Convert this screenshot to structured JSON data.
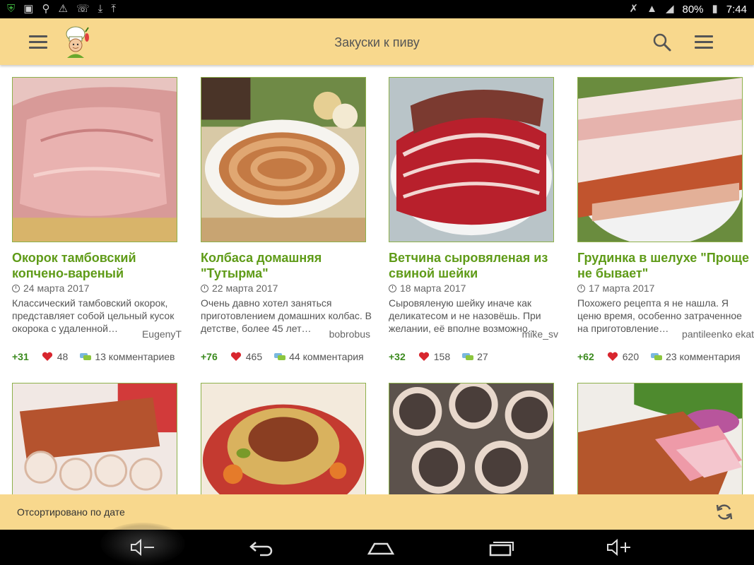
{
  "status_bar": {
    "battery": "80%",
    "time": "7:44"
  },
  "app_bar": {
    "title": "Закуски к пиву"
  },
  "recipes": [
    {
      "title": "Окорок тамбовский копчено-вареный",
      "date": "24 марта 2017",
      "description": "Классический тамбовский окорок, представляет собой цельный кусок окорока с удаленной…",
      "author": "EugenyT",
      "rating": "+31",
      "likes": "48",
      "comments": "13 комментариев"
    },
    {
      "title": "Колбаса домашняя \"Тутырма\"",
      "date": "22 марта 2017",
      "description": "Очень давно хотел заняться приготовлением домашних колбас. В детстве, более 45 лет…",
      "author": "bobrobus",
      "rating": "+76",
      "likes": "465",
      "comments": "44 комментария"
    },
    {
      "title": "Ветчина сыровяленая из свиной шейки",
      "date": "18 марта 2017",
      "description": "Сыровяленую шейку иначе как деликатесом и не назовёшь. При желании, её вполне возможно…",
      "author": "mike_sv",
      "rating": "+32",
      "likes": "158",
      "comments": "27"
    },
    {
      "title": "Грудинка в шелухе \"Проще не бывает\"",
      "date": "17 марта 2017",
      "description": "Похожего рецепта я не нашла. Я ценю время, особенно затраченное на приготовление…",
      "author": "pantileenko ekat",
      "rating": "+62",
      "likes": "620",
      "comments": "23 комментария"
    }
  ],
  "sort_bar": {
    "label": "Отсортировано по дате"
  },
  "colors": {
    "app_bar": "#f8d88d",
    "title_green": "#5f9b18",
    "rating_green": "#3b8a1e",
    "heart_red": "#d8262e"
  }
}
